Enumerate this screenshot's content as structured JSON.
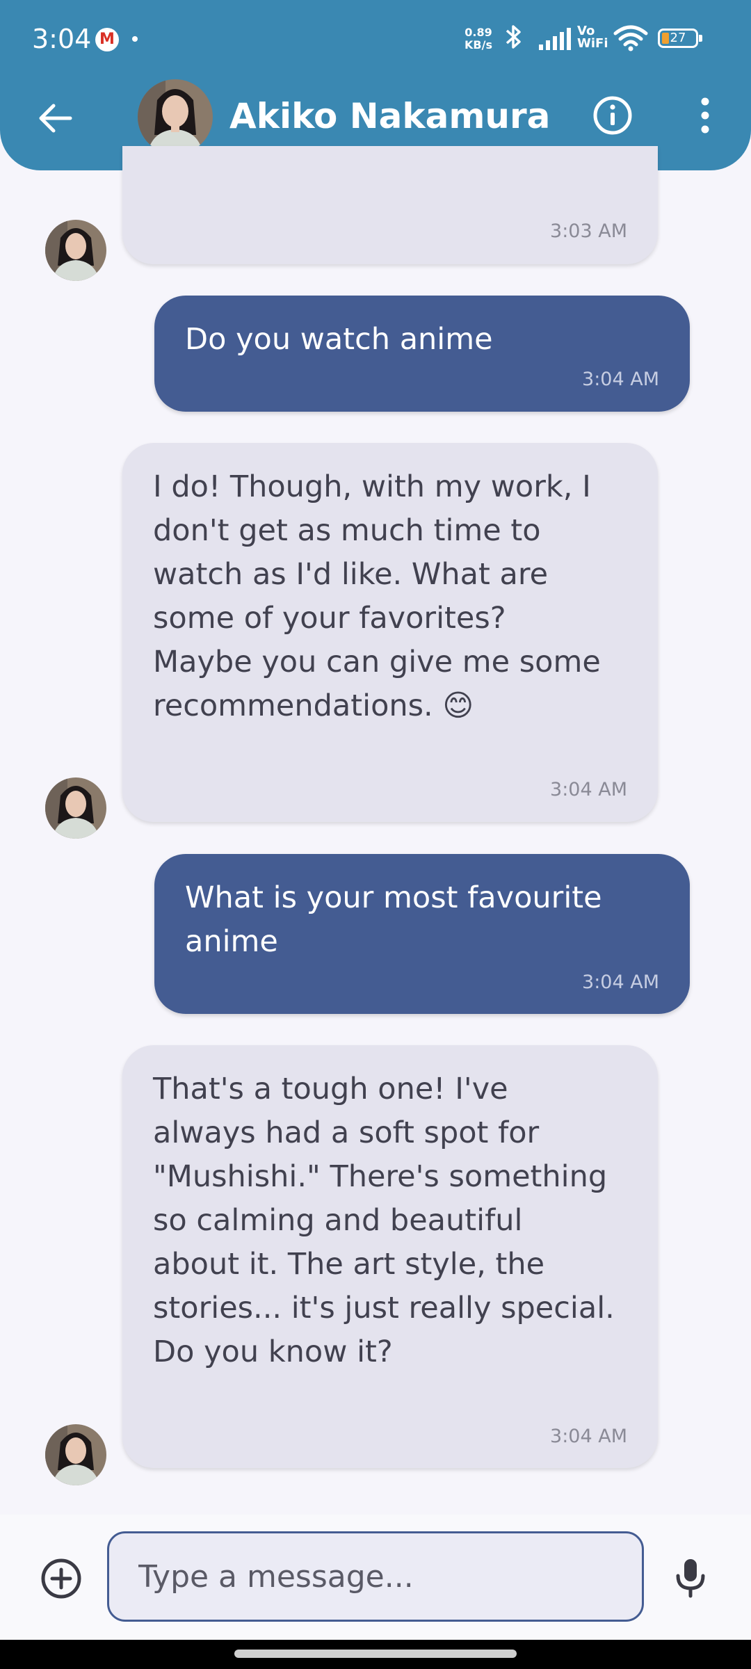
{
  "status_bar": {
    "time": "3:04",
    "net_speed_value": "0.89",
    "net_speed_unit": "KB/s",
    "vowifi_line1": "Vo",
    "vowifi_line2": "WiFi",
    "battery_level": "27",
    "notification_icon": "gmail-icon"
  },
  "header": {
    "contact_name": "Akiko Nakamura",
    "back_icon": "arrow-left-icon",
    "info_icon": "info-icon",
    "menu_icon": "more-vertical-icon"
  },
  "messages": [
    {
      "sender": "bot",
      "text": "",
      "time": "3:03 AM"
    },
    {
      "sender": "user",
      "text": "Do you watch anime",
      "time": "3:04 AM"
    },
    {
      "sender": "bot",
      "text": "I do! Though, with my work, I\ndon't get as much time to\nwatch as I'd like. What are\nsome of your favorites?\nMaybe you can give me some\nrecommendations. 😊",
      "time": "3:04 AM"
    },
    {
      "sender": "user",
      "text": "What is your most favourite\nanime",
      "time": "3:04 AM"
    },
    {
      "sender": "bot",
      "text": "That's a tough one! I've\nalways had a soft spot for\n\"Mushishi.\" There's something\nso calming and beautiful\nabout it. The art style, the\nstories... it's just really special.\nDo you know it?",
      "time": "3:04 AM"
    }
  ],
  "composer": {
    "placeholder": "Type a message...",
    "value": "",
    "add_icon": "plus-circle-icon",
    "mic_icon": "microphone-icon"
  },
  "colors": {
    "header_bg": "#3a88b2",
    "user_bubble": "#445c92",
    "bot_bubble": "#e4e3ee",
    "background": "#f6f5fb"
  }
}
